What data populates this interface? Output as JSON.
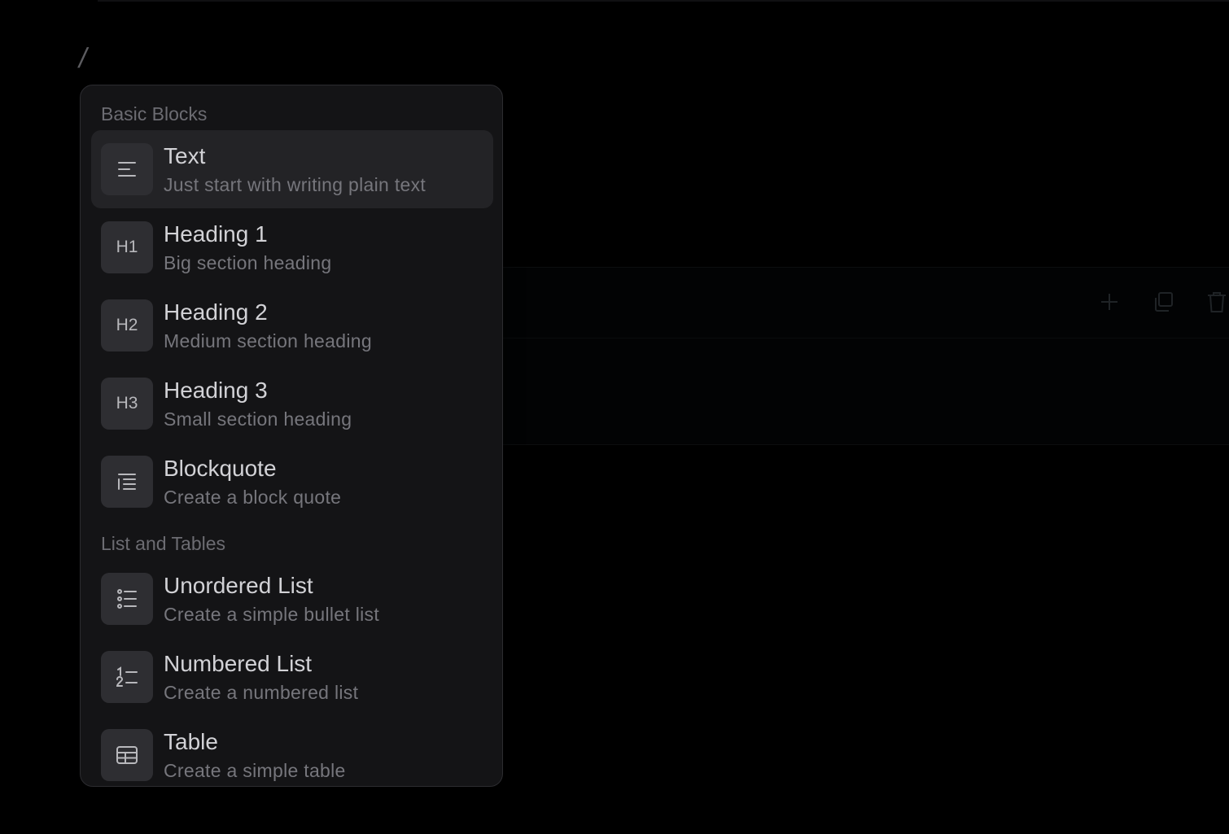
{
  "editor": {
    "slash_text": "/"
  },
  "block_toolbar": {
    "icons": [
      "plus-icon",
      "duplicate-icon",
      "trash-icon"
    ]
  },
  "menu": {
    "sections": [
      {
        "label": "Basic Blocks",
        "items": [
          {
            "title": "Text",
            "description": "Just start with writing plain text",
            "icon": "text-align-icon",
            "icon_text": "",
            "active": true
          },
          {
            "title": "Heading 1",
            "description": "Big section heading",
            "icon": "h1-icon",
            "icon_text": "H1",
            "active": false
          },
          {
            "title": "Heading 2",
            "description": "Medium section heading",
            "icon": "h2-icon",
            "icon_text": "H2",
            "active": false
          },
          {
            "title": "Heading 3",
            "description": "Small section heading",
            "icon": "h3-icon",
            "icon_text": "H3",
            "active": false
          },
          {
            "title": "Blockquote",
            "description": "Create a block quote",
            "icon": "blockquote-icon",
            "icon_text": "",
            "active": false
          }
        ]
      },
      {
        "label": "List and Tables",
        "items": [
          {
            "title": "Unordered List",
            "description": "Create a simple bullet list",
            "icon": "bullet-list-icon",
            "icon_text": "",
            "active": false
          },
          {
            "title": "Numbered List",
            "description": "Create a numbered list",
            "icon": "numbered-list-icon",
            "icon_text": "",
            "active": false
          },
          {
            "title": "Table",
            "description": "Create a simple table",
            "icon": "table-icon",
            "icon_text": "",
            "active": false
          }
        ]
      }
    ]
  },
  "colors": {
    "background": "#000000",
    "menu_bg": "#141416",
    "active_item_bg": "#232326",
    "icon_box_bg": "#2e2e32"
  }
}
